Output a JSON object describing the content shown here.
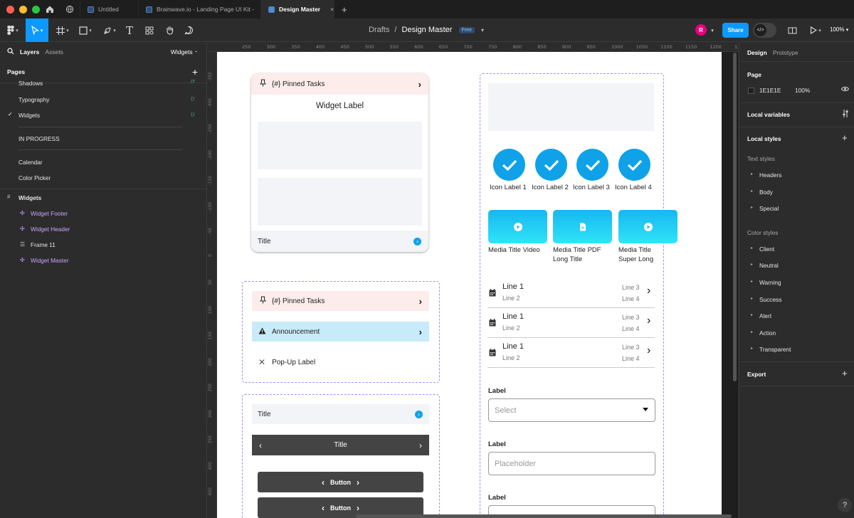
{
  "tabs": [
    {
      "label": "Untitled"
    },
    {
      "label": "Brainwave.io - Landing Page UI Kit -"
    },
    {
      "label": "Design Master",
      "close": "×"
    }
  ],
  "toolbar": {
    "breadcrumb_drafts": "Drafts",
    "breadcrumb_sep": "/",
    "file_name": "Design Master",
    "plan_badge": "Free",
    "avatar_initial": "R",
    "share_label": "Share",
    "zoom_level": "100%"
  },
  "left_panel": {
    "tab_layers": "Layers",
    "tab_assets": "Assets",
    "current_page": "Widgets",
    "pages_header": "Pages",
    "pages": [
      "Shadows",
      "Typography",
      "Widgets",
      "IN PROGRESS",
      "Calendar",
      "Color Picker"
    ],
    "layers_root": "Widgets",
    "layers": [
      "Widget Footer",
      "Widget Header",
      "Frame 11",
      "Widget Master"
    ]
  },
  "ruler": {
    "top": [
      "250",
      "300",
      "350",
      "400",
      "450",
      "500",
      "550",
      "600",
      "650",
      "700",
      "750",
      "800",
      "850",
      "900",
      "950",
      "1000",
      "1050",
      "1100",
      "1150",
      "1200",
      "1250"
    ],
    "left": [
      "-350",
      "-300",
      "-250",
      "-200",
      "-150",
      "-100",
      "-50",
      "0",
      "50",
      "100",
      "150",
      "200",
      "250",
      "300",
      "350",
      "400",
      "450"
    ]
  },
  "right_panel": {
    "tab_design": "Design",
    "tab_prototype": "Prototype",
    "page_header": "Page",
    "page_color": "1E1E1E",
    "page_opacity": "100%",
    "local_variables": "Local variables",
    "local_styles": "Local styles",
    "text_styles_header": "Text styles",
    "text_styles": [
      "Headers",
      "Body",
      "Special"
    ],
    "color_styles_header": "Color styles",
    "color_styles": [
      "Client",
      "Neutral",
      "Warning",
      "Success",
      "Alert",
      "Action",
      "Transparent"
    ],
    "export": "Export"
  },
  "canvas": {
    "card1": {
      "pinned": "{#} Pinned Tasks",
      "widget_label": "Widget Label",
      "footer_title": "Title"
    },
    "group2": {
      "pinned": "{#} Pinned Tasks",
      "announcement": "Announcement",
      "popup": "Pop-Up Label"
    },
    "group3": {
      "title1": "Title",
      "title2": "Title",
      "button1": "Button",
      "button2": "Button"
    },
    "icons": [
      "Icon Label 1",
      "Icon Label 2",
      "Icon Label 3",
      "Icon Label 4"
    ],
    "media": [
      {
        "line1": "Media Title Video",
        "line2": ""
      },
      {
        "line1": "Media Title PDF",
        "line2": "Long Title"
      },
      {
        "line1": "Media Title",
        "line2": "Super Long"
      }
    ],
    "list": [
      {
        "l1": "Line 1",
        "l2": "Line 2",
        "l3": "Line 3",
        "l4": "Line 4"
      },
      {
        "l1": "Line 1",
        "l2": "Line 2",
        "l3": "Line 3",
        "l4": "Line 4"
      },
      {
        "l1": "Line 1",
        "l2": "Line 2",
        "l3": "Line 3",
        "l4": "Line 4"
      }
    ],
    "form": {
      "label1": "Label",
      "select_placeholder": "Select",
      "label2": "Label",
      "input_placeholder": "Placeholder",
      "label3": "Label"
    }
  },
  "help": "?"
}
